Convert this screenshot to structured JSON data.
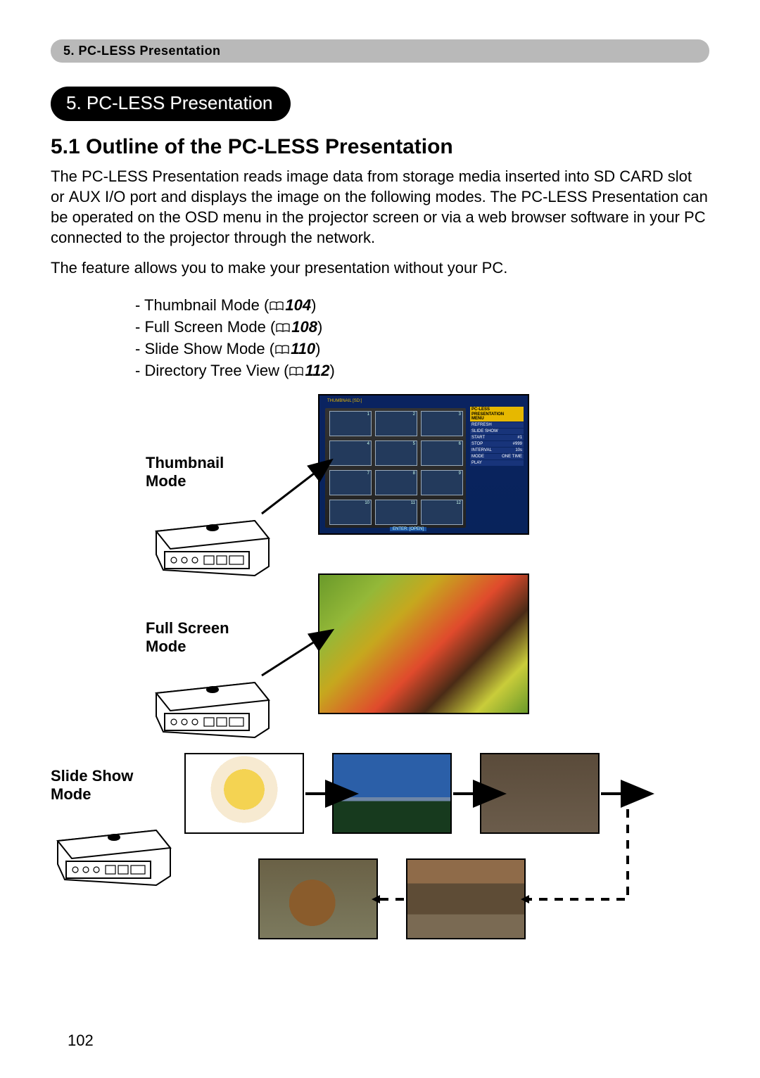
{
  "breadcrumb": "5. PC-LESS Presentation",
  "chapter_pill": "5. PC-LESS Presentation",
  "section_heading": "5.1 Outline of the PC-LESS Presentation",
  "para1_pre_aux": "The PC-LESS Presentation reads image data from storage media inserted into SD CARD slot or ",
  "aux_io": "AUX I/O",
  "para1_post_aux": " port and displays the image on the following modes. The PC-LESS Presentation can be operated on the OSD menu in the projector screen or via a web browser software in your PC connected to the projector through the network.",
  "para2": "The feature allows you to make your presentation without your PC.",
  "modes": [
    {
      "name": "Thumbnail Mode",
      "page": "104"
    },
    {
      "name": "Full Screen Mode",
      "page": "108"
    },
    {
      "name": "Slide Show Mode",
      "page": "110"
    },
    {
      "name": "Directory Tree View",
      "page": "112"
    }
  ],
  "diagram_labels": {
    "thumbnail": "Thumbnail\nMode",
    "fullscreen": "Full Screen\nMode",
    "slideshow": "Slide Show\nMode"
  },
  "thumb_screen": {
    "title": "THUMBNAIL  [SD:]",
    "enter": "ENTER: [OPEN]",
    "menu_header1": "PC-LESS",
    "menu_header2": "PRESENTATION",
    "menu_header3": "MENU",
    "items": [
      {
        "l": "REFRESH",
        "r": ""
      },
      {
        "l": "SLIDE SHOW",
        "r": ""
      },
      {
        "l": "START",
        "r": "#1"
      },
      {
        "l": "STOP",
        "r": "#999"
      },
      {
        "l": "INTERVAL",
        "r": "10s"
      },
      {
        "l": "MODE",
        "r": "ONE TIME"
      },
      {
        "l": "PLAY",
        "r": ""
      }
    ],
    "cell_numbers": [
      "1",
      "2",
      "3",
      "4",
      "5",
      "6",
      "7",
      "8",
      "9",
      "10",
      "11",
      "12"
    ]
  },
  "page_number": "102"
}
